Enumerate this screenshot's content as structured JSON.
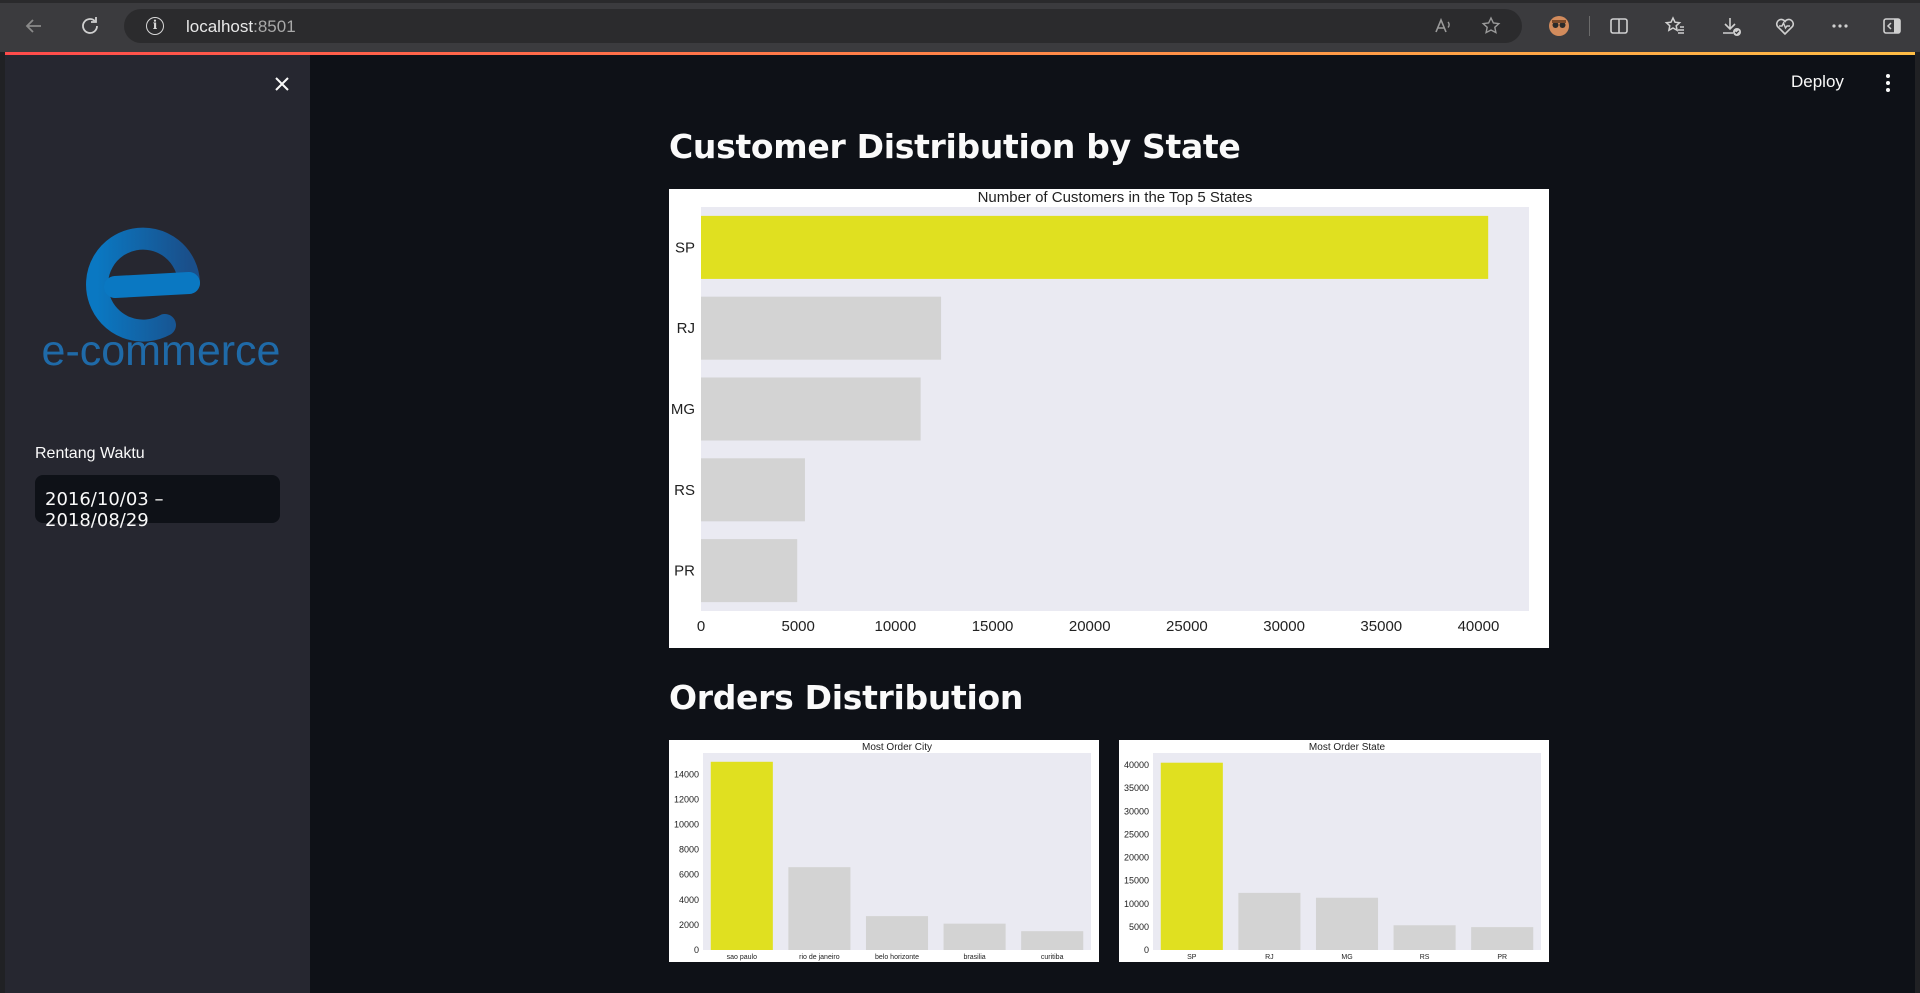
{
  "browser": {
    "url_host": "localhost",
    "url_port": ":8501"
  },
  "sidebar": {
    "logo_text": "e-commerce",
    "date_range_label": "Rentang Waktu",
    "date_range_value": "2016/10/03 – 2018/08/29"
  },
  "header": {
    "deploy_label": "Deploy"
  },
  "main": {
    "section1_title": "Customer Distribution by State",
    "section2_title": "Orders Distribution"
  },
  "colors": {
    "highlight": "#e0e020",
    "bar_default": "#d3d3d3",
    "plot_bg": "#eaeaf2",
    "app_bg": "#0e1117",
    "sidebar_bg": "#262730"
  },
  "chart_data": [
    {
      "type": "bar",
      "orientation": "horizontal",
      "title": "Number of Customers in the Top 5 States",
      "categories": [
        "SP",
        "RJ",
        "MG",
        "RS",
        "PR"
      ],
      "values": [
        40500,
        12350,
        11300,
        5350,
        4950
      ],
      "highlight_index": 0,
      "xlim": [
        0,
        42600
      ],
      "xticks": [
        "0",
        "5000",
        "10000",
        "15000",
        "20000",
        "25000",
        "30000",
        "35000",
        "40000"
      ],
      "xlabel": "",
      "ylabel": ""
    },
    {
      "type": "bar",
      "title": "Most Order City",
      "categories": [
        "sao paulo",
        "rio de janeiro",
        "belo horizonte",
        "brasilia",
        "curitiba"
      ],
      "values": [
        15000,
        6600,
        2700,
        2100,
        1500
      ],
      "highlight_index": 0,
      "ylim": [
        0,
        15700
      ],
      "yticks": [
        "0",
        "2000",
        "4000",
        "6000",
        "8000",
        "10000",
        "12000",
        "14000"
      ],
      "xlabel": "",
      "ylabel": ""
    },
    {
      "type": "bar",
      "title": "Most Order State",
      "categories": [
        "SP",
        "RJ",
        "MG",
        "RS",
        "PR"
      ],
      "values": [
        40500,
        12350,
        11300,
        5350,
        4950
      ],
      "highlight_index": 0,
      "ylim": [
        0,
        42600
      ],
      "yticks": [
        "0",
        "5000",
        "10000",
        "15000",
        "20000",
        "25000",
        "30000",
        "35000",
        "40000"
      ],
      "xlabel": "",
      "ylabel": ""
    }
  ]
}
